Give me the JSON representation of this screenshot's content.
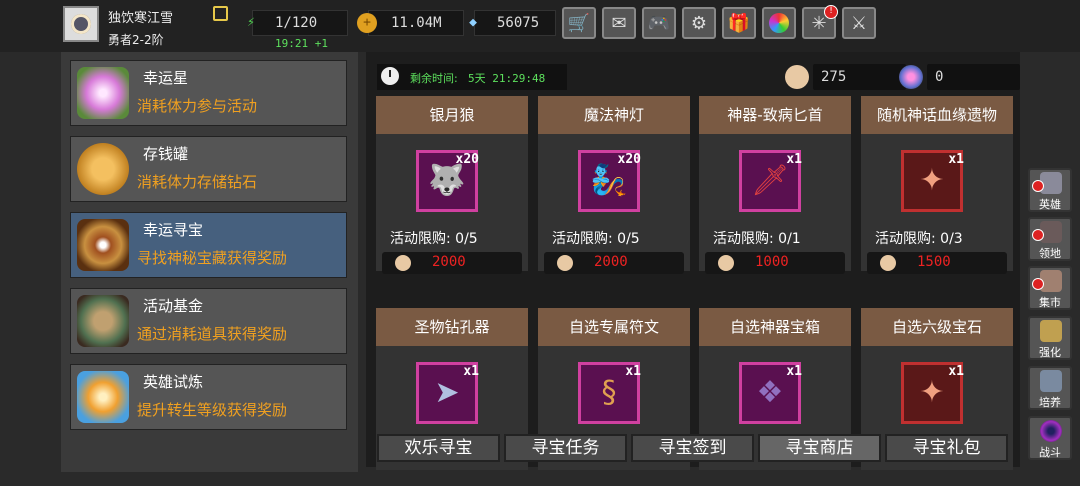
{
  "player": {
    "name": "独饮寒江雪",
    "rank": "勇者2-2阶"
  },
  "resources": {
    "stamina": "1/120",
    "stamina_regen": "19:21 +1",
    "gold": "11.04M",
    "diamonds": "56075"
  },
  "toolbar": {
    "icons": [
      "shop-cart-icon",
      "mail-icon",
      "gamepad-icon",
      "gear-icon",
      "gift-icon",
      "color-wheel-icon",
      "fireworks-icon",
      "crossed-swords-icon"
    ]
  },
  "sidebar": {
    "items": [
      {
        "title": "幸运星",
        "desc": "消耗体力参与活动"
      },
      {
        "title": "存钱罐",
        "desc": "消耗体力存储钻石"
      },
      {
        "title": "幸运寻宝",
        "desc": "寻找神秘宝藏获得奖励"
      },
      {
        "title": "活动基金",
        "desc": "通过消耗道具获得奖励"
      },
      {
        "title": "英雄试炼",
        "desc": "提升转生等级获得奖励"
      }
    ],
    "selected_index": 2
  },
  "shop": {
    "timer_label": "剩余时间:",
    "timer_value": "5天 21:29:48",
    "currency1": "275",
    "currency2": "0",
    "items": [
      {
        "name": "银月狼",
        "qty": "x20",
        "limit": "活动限购: 0/5",
        "price": "2000"
      },
      {
        "name": "魔法神灯",
        "qty": "x20",
        "limit": "活动限购: 0/5",
        "price": "2000"
      },
      {
        "name": "神器-致病匕首",
        "qty": "x1",
        "limit": "活动限购: 0/1",
        "price": "1000"
      },
      {
        "name": "随机神话血缘遗物",
        "qty": "x1",
        "limit": "活动限购: 0/3",
        "price": "1500"
      },
      {
        "name": "圣物钻孔器",
        "qty": "x1"
      },
      {
        "name": "自选专属符文",
        "qty": "x1"
      },
      {
        "name": "自选神器宝箱",
        "qty": "x1"
      },
      {
        "name": "自选六级宝石",
        "qty": "x1"
      }
    ]
  },
  "tabs": [
    "欢乐寻宝",
    "寻宝任务",
    "寻宝签到",
    "寻宝商店",
    "寻宝礼包"
  ],
  "active_tab": 3,
  "right_nav": [
    "英雄",
    "领地",
    "集市",
    "强化",
    "培养",
    "战斗"
  ],
  "colors": {
    "accent_orange": "#f0a020",
    "timer_green": "#5de05d",
    "price_red": "#e22222",
    "selected_blue": "#46607e",
    "card_header": "#7a5a43"
  }
}
